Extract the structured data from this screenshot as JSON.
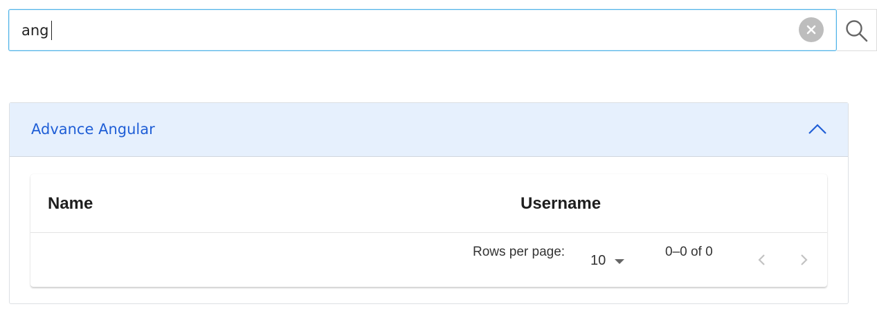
{
  "search": {
    "value": "ang",
    "clear_icon": "close-icon",
    "search_icon": "search-icon"
  },
  "panel": {
    "title": "Advance Angular",
    "expanded": true,
    "chevron_icon": "chevron-up-icon",
    "accent_color": "#1f5ed6",
    "header_background": "#e6f0fd"
  },
  "table": {
    "columns": [
      "Name",
      "Username"
    ],
    "rows": []
  },
  "paginator": {
    "rows_per_page_label": "Rows per page:",
    "rows_per_page_value": "10",
    "range_label": "0–0 of 0",
    "prev_icon": "chevron-left-icon",
    "next_icon": "chevron-right-icon"
  }
}
